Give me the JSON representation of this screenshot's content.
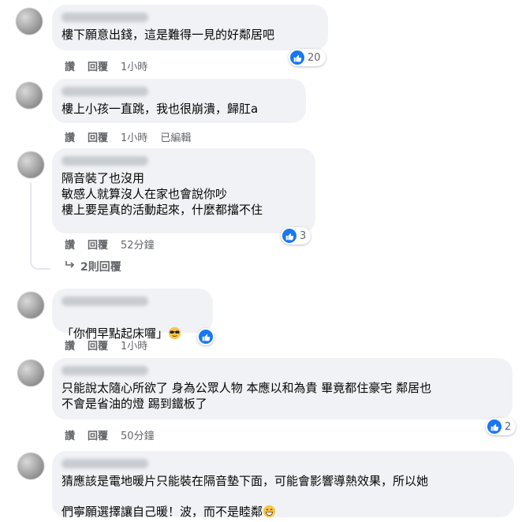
{
  "labels": {
    "like": "讚",
    "reply": "回覆",
    "edited": "已編輯"
  },
  "comments": [
    {
      "text": "樓下願意出錢，這是難得一見的好鄰居吧",
      "time": "1小時",
      "reactions": "20"
    },
    {
      "text": "樓上小孩一直跳，我也很崩潰，歸肛a",
      "time": "1小時"
    },
    {
      "text": "隔音裝了也沒用\n敏感人就算沒人在家也會說你吵\n樓上要是真的活動起來，什麼都擋不住",
      "time": "52分鐘",
      "reactions": "3",
      "replies_link": "2則回覆"
    },
    {
      "text": "「你們早點起床囉」",
      "emoji": "sunglasses-emoji",
      "time": "1小時"
    },
    {
      "text": "只能說太隨心所欲了 身為公眾人物 本應以和為貴 畢竟都住豪宅 鄰居也\n不會是省油的燈 踢到鐵板了",
      "time": "50分鐘",
      "reactions": "2"
    },
    {
      "text": "猜應該是電地暖片只能裝在隔音墊下面，可能會影響導熱效果，所以她\n們寧願選擇讓自己暖！波，而不是睦鄰",
      "emoji": "grinning-emoji"
    }
  ],
  "colors": {
    "bubble": "#f0f2f5",
    "secondary_text": "#65676b",
    "like_blue": "#1877f2"
  }
}
